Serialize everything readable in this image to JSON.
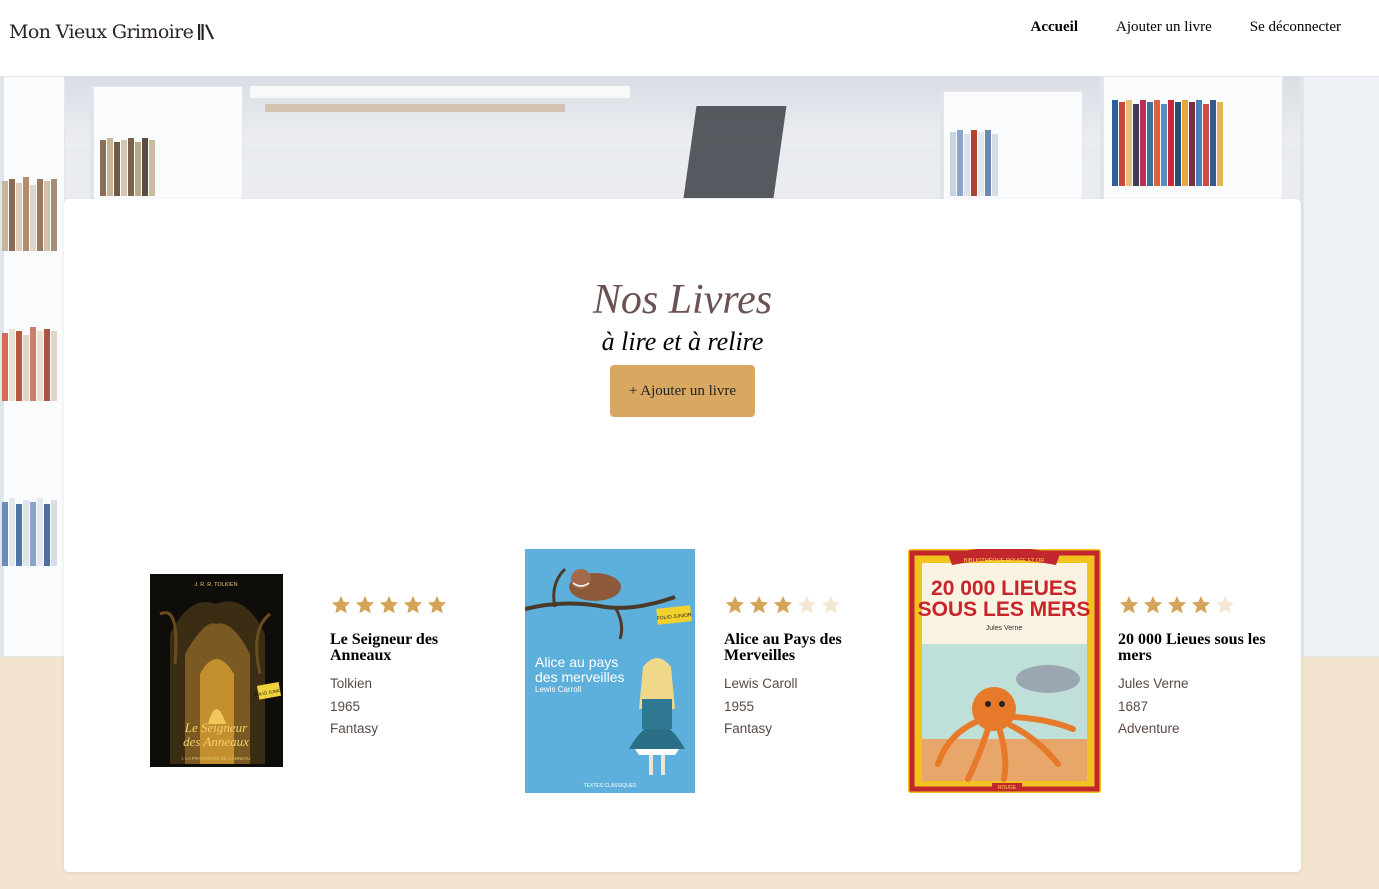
{
  "brand": {
    "name": "Mon Vieux Grimoire"
  },
  "nav": {
    "items": [
      {
        "label": "Accueil",
        "active": true
      },
      {
        "label": "Ajouter un livre",
        "active": false
      },
      {
        "label": "Se déconnecter",
        "active": false
      }
    ]
  },
  "main": {
    "title": "Nos Livres",
    "subtitle": "à lire et à relire",
    "add_button": "+ Ajouter un livre"
  },
  "books": [
    {
      "title": "Le Seigneur des Anneaux",
      "author": "Tolkien",
      "year": "1965",
      "genre": "Fantasy",
      "rating": 5,
      "cover": {
        "author": "J. R. R. TOLKIEN",
        "title_line1": "Le Seigneur",
        "title_line2": "des Anneaux",
        "subtitle": "I. LA FRATERNITÉ DE L'ANNEAU",
        "badge": "FOLIO JUNIOR"
      }
    },
    {
      "title": "Alice au Pays des Merveilles",
      "author": "Lewis Caroll",
      "year": "1955",
      "genre": "Fantasy",
      "rating": 3,
      "cover": {
        "title_line1": "Alice au pays",
        "title_line2": "des merveilles",
        "author": "Lewis Carroll",
        "badge": "FOLIO JUNIOR",
        "footer": "TEXTES CLASSIQUES"
      }
    },
    {
      "title": "20 000 Lieues sous les mers",
      "author": "Jules Verne",
      "year": "1687",
      "genre": "Adventure",
      "rating": 4,
      "cover": {
        "series": "BIBLIOTHÈQUE ROUGE ET OR",
        "title_line1": "20 000 LIEUES",
        "title_line2": "SOUS LES MERS",
        "author": "Jules Verne",
        "footer": "ROUGE"
      }
    }
  ],
  "colors": {
    "accent": "#d8a863",
    "star_filled": "#d3a357",
    "star_empty": "#f4e6d2",
    "title": "#6a5252",
    "page_bg": "#f3e4cf"
  }
}
